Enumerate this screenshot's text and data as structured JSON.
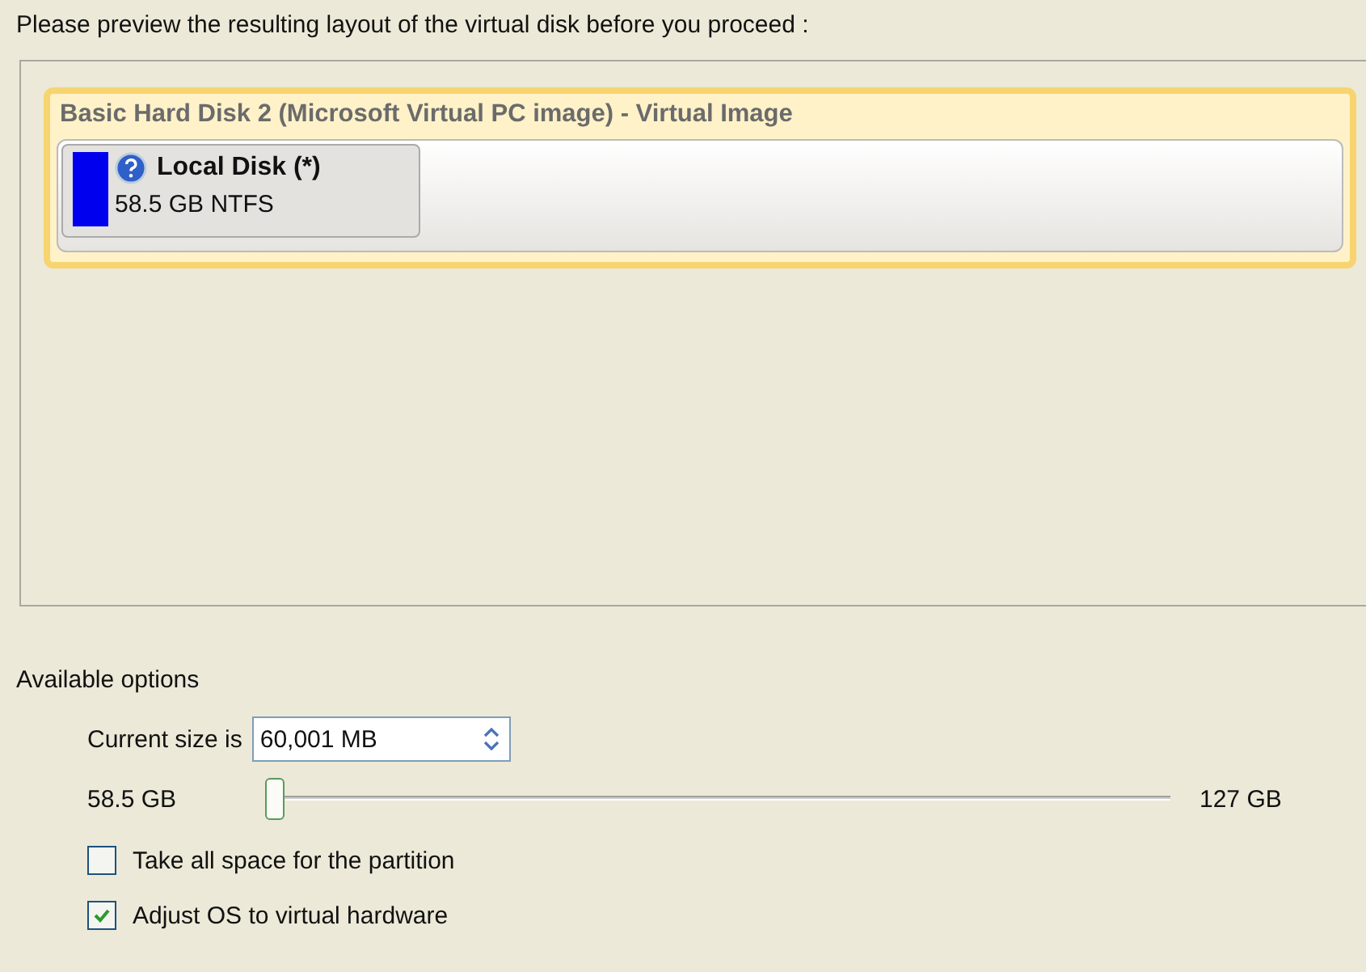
{
  "heading": "Please preview the resulting layout of the virtual disk before you proceed :",
  "disk": {
    "title": "Basic Hard Disk 2 (Microsoft Virtual PC image) - Virtual Image",
    "partitions": [
      {
        "name": "Local Disk (*)",
        "detail": "58.5 GB NTFS",
        "color": "#0000ee"
      }
    ]
  },
  "options": {
    "label": "Available options",
    "size_label": "Current size is",
    "size_value": "60,001 MB",
    "slider": {
      "min_label": "58.5 GB",
      "max_label": "127 GB",
      "level": 0
    },
    "checkboxes": [
      {
        "label": "Take all space for the partition",
        "checked": false
      },
      {
        "label": "Adjust OS to virtual hardware",
        "checked": true
      }
    ]
  }
}
